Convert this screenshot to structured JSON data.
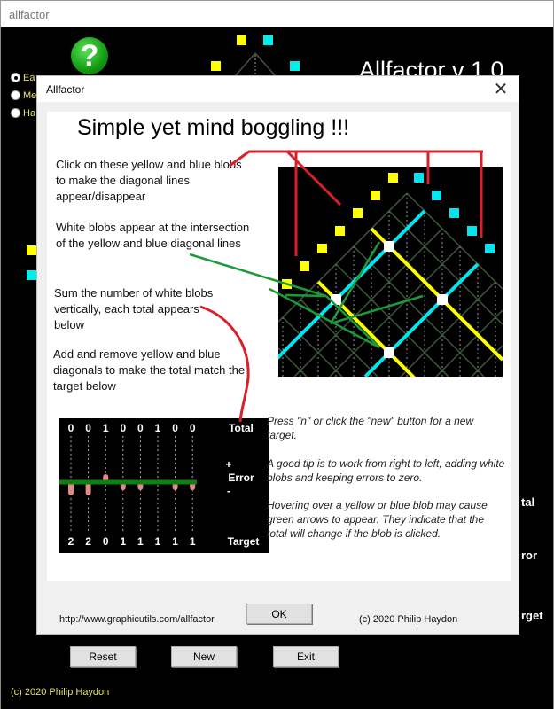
{
  "window": {
    "title": "allfactor"
  },
  "app": {
    "title": "Allfactor  v 1.0",
    "help_icon": "?",
    "difficulty": [
      {
        "label": "Ea",
        "selected": true
      },
      {
        "label": "Me",
        "selected": false
      },
      {
        "label": "Ha",
        "selected": false
      }
    ],
    "side_labels": {
      "total": "tal",
      "error": "ror",
      "target": "rget"
    },
    "buttons": {
      "reset": "Reset",
      "new": "New",
      "exit": "Exit"
    },
    "copyright": "(c) 2020 Philip Haydon",
    "colors": {
      "yellow": "#ffff00",
      "blue": "#00e5ee",
      "grid": "#3d5a3d",
      "accent_green": "#0f7f0f"
    }
  },
  "dialog": {
    "title": "Allfactor",
    "close_icon": "close-icon",
    "heading": "Simple yet mind boggling  !!!",
    "instructions": [
      "Click on these yellow and blue blobs to make the diagonal lines appear/disappear",
      "White blobs appear at the intersection of the yellow and blue diagonal lines",
      "Sum the number of white blobs vertically, each total appears below",
      "Add and remove yellow and blue diagonals to make the total match the target below"
    ],
    "tips": [
      "Press  \"n\" or click the \"new\" button for a new target.",
      "A good tip is to work from right to left, adding white blobs and keeping errors to zero.",
      "Hovering over a yellow or blue blob may cause green arrows to appear. They indicate that the total will change if the blob is clicked."
    ],
    "example": {
      "totals": [
        0,
        0,
        1,
        0,
        0,
        1,
        0,
        0
      ],
      "targets": [
        2,
        2,
        0,
        1,
        1,
        1,
        1,
        1
      ],
      "total_label": "Total",
      "error_plus": "+",
      "error_label": "Error",
      "error_minus": "-",
      "target_label": "Target"
    },
    "url": "http://www.graphicutils.com/allfactor",
    "ok_label": "OK",
    "copyright": "(c) 2020  Philip Haydon"
  }
}
